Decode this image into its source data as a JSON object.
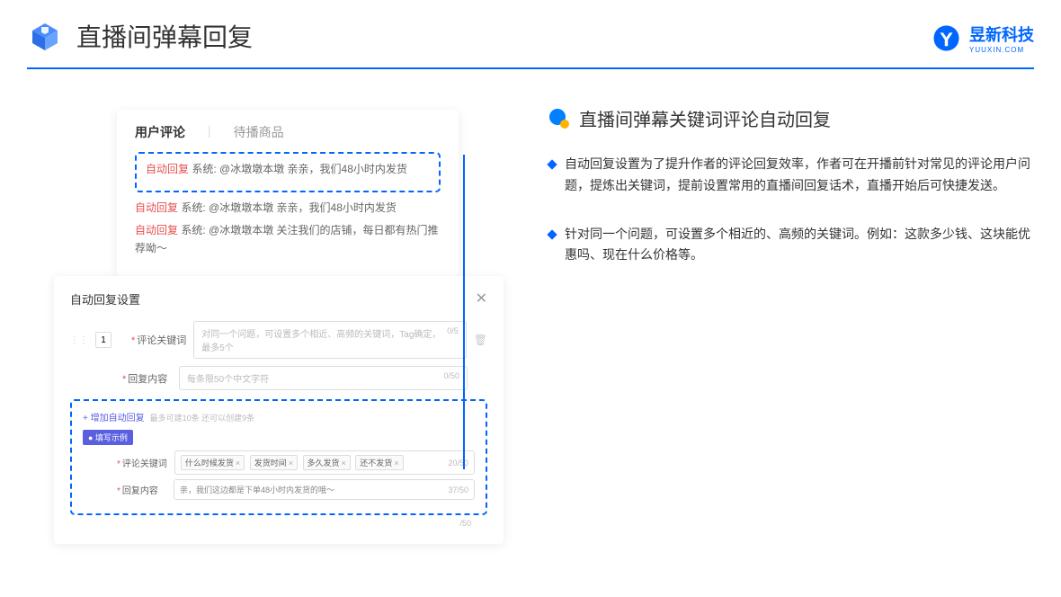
{
  "header": {
    "title": "直播间弹幕回复"
  },
  "brand": {
    "name": "昱新科技",
    "sub": "YUUXIN.COM"
  },
  "card1": {
    "tab1": "用户评论",
    "tab2": "待播商品",
    "line1_tag": "自动回复",
    "line1_text": " 系统: @冰墩墩本墩 亲亲，我们48小时内发货",
    "line2_tag": "自动回复",
    "line2_text": " 系统: @冰墩墩本墩 亲亲，我们48小时内发货",
    "line3_tag": "自动回复",
    "line3_text": " 系统: @冰墩墩本墩 关注我们的店铺，每日都有热门推荐呦～"
  },
  "card2": {
    "title": "自动回复设置",
    "close": "✕",
    "idx": "1",
    "label_kw": "评论关键词",
    "ph_kw": "对同一个问题，可设置多个相近、高频的关键词，Tag确定，最多5个",
    "count_kw": "0/5",
    "label_content": "回复内容",
    "ph_content": "每条限50个中文字符",
    "count_content": "0/50",
    "addlink": "+ 增加自动回复",
    "addhint": "最多可建10条 还可以创建9条",
    "example_badge": "● 填写示例",
    "ex_label_kw": "评论关键词",
    "ex_tag1": "什么时候发货",
    "ex_tag2": "发货时间",
    "ex_tag3": "多久发货",
    "ex_tag4": "还不发货",
    "ex_count_kw": "20/50",
    "ex_label_content": "回复内容",
    "ex_content": "亲，我们这边都是下单48小时内发货的哦～",
    "ex_count_content": "37/50",
    "count_outer": "/50"
  },
  "right": {
    "title": "直播间弹幕关键词评论自动回复",
    "b1": "自动回复设置为了提升作者的评论回复效率，作者可在开播前针对常见的评论用户问题，提炼出关键词，提前设置常用的直播间回复话术，直播开始后可快捷发送。",
    "b2": "针对同一个问题，可设置多个相近的、高频的关键词。例如：这款多少钱、这块能优惠吗、现在什么价格等。"
  }
}
